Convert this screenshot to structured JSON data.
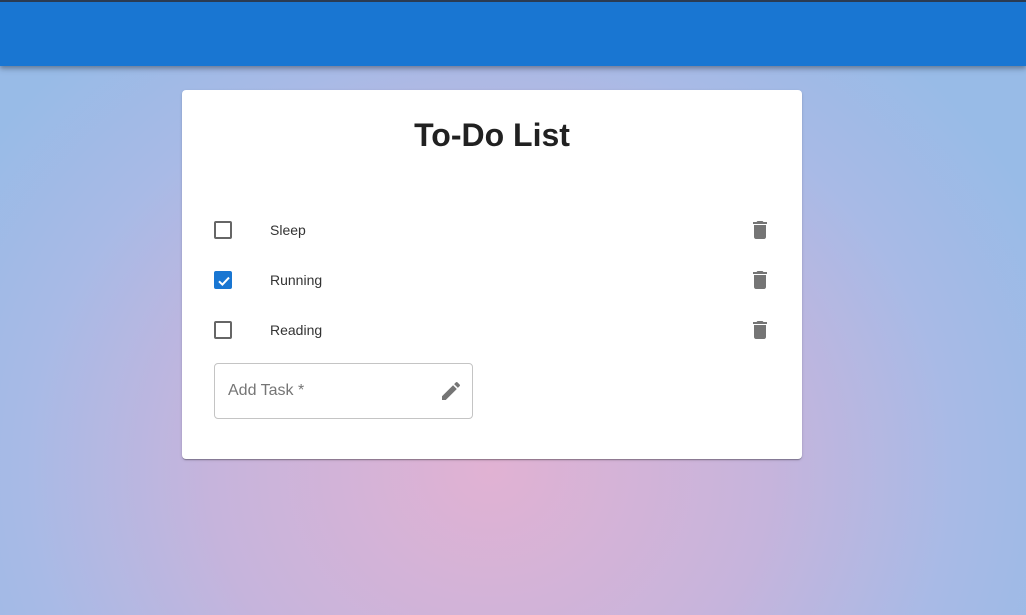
{
  "header": {
    "color": "#1976d2"
  },
  "card": {
    "title": "To-Do List"
  },
  "tasks": [
    {
      "label": "Sleep",
      "checked": false,
      "delete_icon": "trash-icon"
    },
    {
      "label": "Running",
      "checked": true,
      "delete_icon": "trash-icon"
    },
    {
      "label": "Reading",
      "checked": false,
      "delete_icon": "trash-icon"
    }
  ],
  "add_task": {
    "placeholder": "Add Task *",
    "value": "",
    "icon": "pencil-icon"
  },
  "colors": {
    "accent": "#1976d2",
    "icon_gray": "#757575",
    "text": "#212121"
  }
}
